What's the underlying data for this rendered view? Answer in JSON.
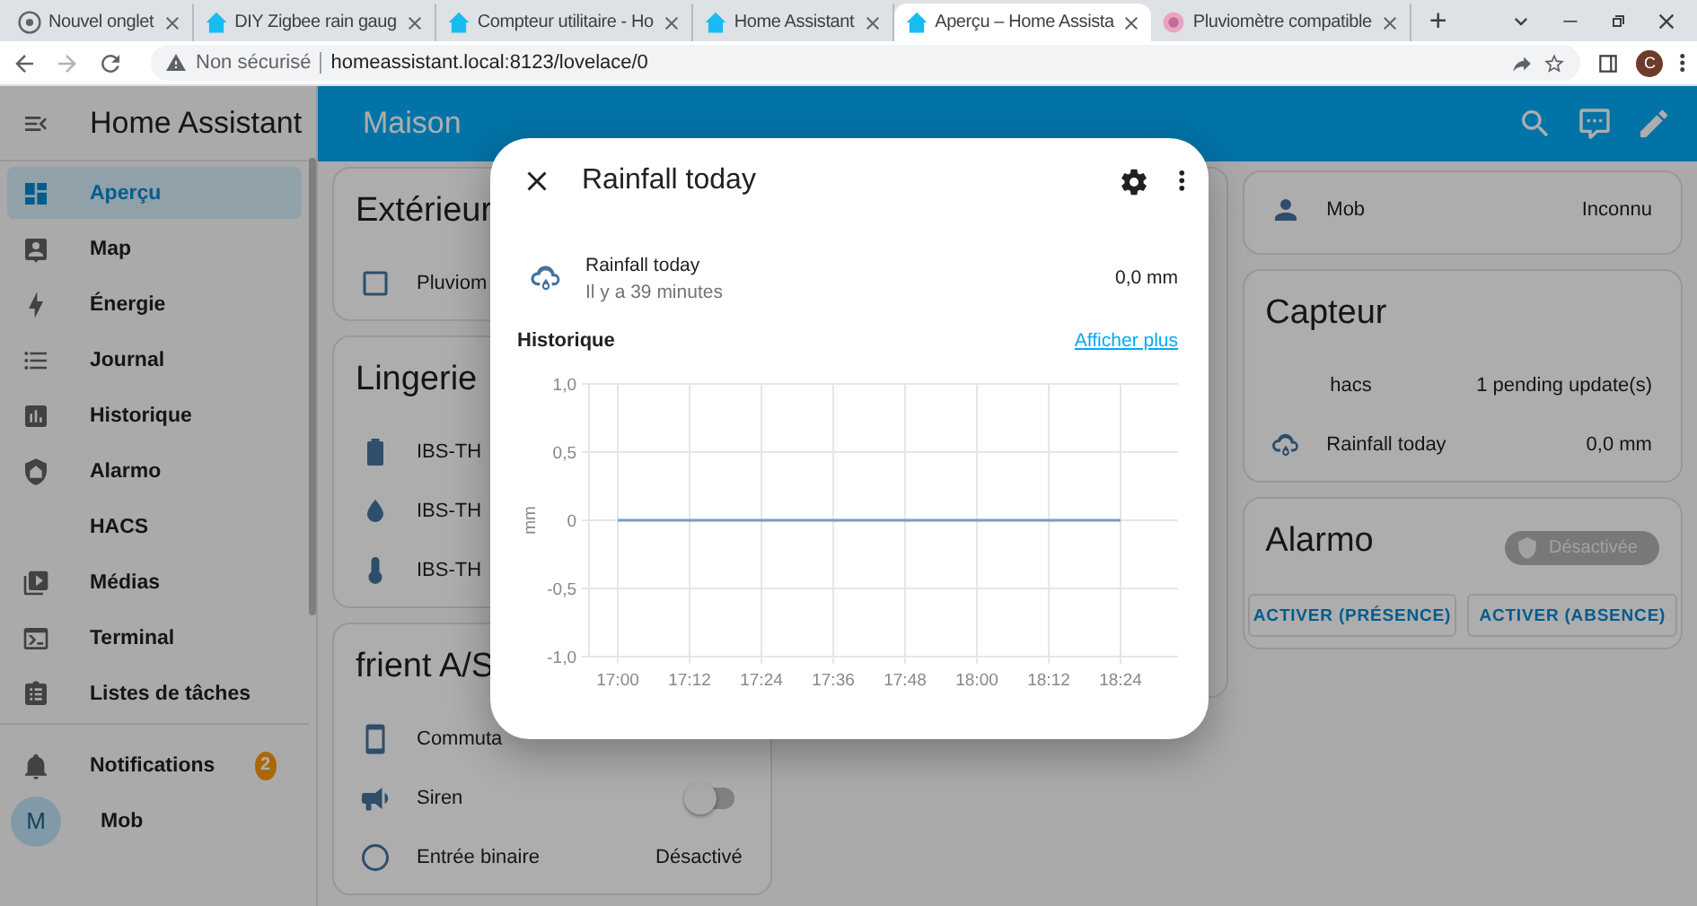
{
  "browser": {
    "tabs": [
      {
        "title": "Nouvel onglet",
        "kind": "chrome",
        "selected": false
      },
      {
        "title": "DIY Zigbee rain gaug",
        "kind": "ha",
        "selected": false
      },
      {
        "title": "Compteur utilitaire - Ho",
        "kind": "ha",
        "selected": false
      },
      {
        "title": "Home Assistant",
        "kind": "ha",
        "selected": false
      },
      {
        "title": "Aperçu – Home Assista",
        "kind": "ha",
        "selected": true
      },
      {
        "title": "Pluviomètre compatible",
        "kind": "web",
        "selected": false
      }
    ],
    "new_tab": "+",
    "security": "Non sécurisé",
    "url": "homeassistant.local:8123/lovelace/0",
    "profile": "C"
  },
  "sidebar": {
    "title": "Home Assistant",
    "items": [
      {
        "label": "Aperçu",
        "kind": "dashboard",
        "selected": true
      },
      {
        "label": "Map",
        "kind": "map",
        "selected": false
      },
      {
        "label": "Énergie",
        "kind": "energy",
        "selected": false
      },
      {
        "label": "Journal",
        "kind": "logbook",
        "selected": false
      },
      {
        "label": "Historique",
        "kind": "history",
        "selected": false
      },
      {
        "label": "Alarmo",
        "kind": "shield",
        "selected": false
      },
      {
        "label": "HACS",
        "kind": "none",
        "selected": false
      },
      {
        "label": "Médias",
        "kind": "media",
        "selected": false
      },
      {
        "label": "Terminal",
        "kind": "terminal",
        "selected": false
      },
      {
        "label": "Listes de tâches",
        "kind": "todo",
        "selected": false
      }
    ],
    "notifications": {
      "label": "Notifications",
      "badge": "2"
    },
    "user": {
      "initial": "M",
      "name": "Mob"
    }
  },
  "header": {
    "title": "Maison"
  },
  "columns": [
    [
      {
        "title": "Extérieur",
        "rows": [
          {
            "kind": "checkbox",
            "name": "Pluviom"
          }
        ]
      },
      {
        "title": "Lingerie",
        "rows": [
          {
            "kind": "battery",
            "name": "IBS-TH"
          },
          {
            "kind": "humidity",
            "name": "IBS-TH"
          },
          {
            "kind": "thermometer",
            "name": "IBS-TH"
          }
        ]
      },
      {
        "title": "frient A/S",
        "rows": [
          {
            "kind": "phone",
            "name": "Commuta"
          },
          {
            "kind": "siren",
            "name": "Siren",
            "on": false
          },
          {
            "kind": "circle",
            "name": "Entrée binaire",
            "value": "Désactivé"
          }
        ]
      }
    ],
    [
      {}
    ],
    [
      {
        "rows": [
          {
            "kind": "person",
            "name": "Mob",
            "value": "Inconnu"
          }
        ]
      },
      {
        "title": "Capteur",
        "rows": [
          {
            "kind": "none",
            "name": "hacs",
            "value": "1 pending update(s)"
          },
          {
            "kind": "rain",
            "name": "Rainfall today",
            "value": "0,0 mm"
          }
        ]
      },
      {
        "title": "Alarmo",
        "badge": "Désactivée",
        "buttons": [
          "ACTIVER (PRÉSENCE)",
          "ACTIVER (ABSENCE)"
        ]
      }
    ]
  ],
  "dialog": {
    "title": "Rainfall today",
    "entity": {
      "name": "Rainfall today",
      "time": "Il y a 39 minutes",
      "value": "0,0 mm"
    },
    "history_title": "Historique",
    "more_link": "Afficher plus",
    "chart_data": {
      "type": "line",
      "ylabel": "mm",
      "categories": [
        "17:00",
        "17:12",
        "17:24",
        "17:36",
        "17:48",
        "18:00",
        "18:12",
        "18:24"
      ],
      "series": [
        {
          "color": "#7a9cc6",
          "values": [
            0,
            0,
            0,
            0,
            0,
            0,
            0,
            0
          ]
        }
      ],
      "ylim": [
        -1,
        1
      ],
      "grid": true,
      "yticks": [
        {
          "value": 1,
          "label": "1,0"
        },
        {
          "value": 0.5,
          "label": "0,5"
        },
        {
          "value": 0,
          "label": "0"
        },
        {
          "value": -0.5,
          "label": "-0,5"
        },
        {
          "value": -1,
          "label": "-1,0"
        }
      ]
    }
  }
}
